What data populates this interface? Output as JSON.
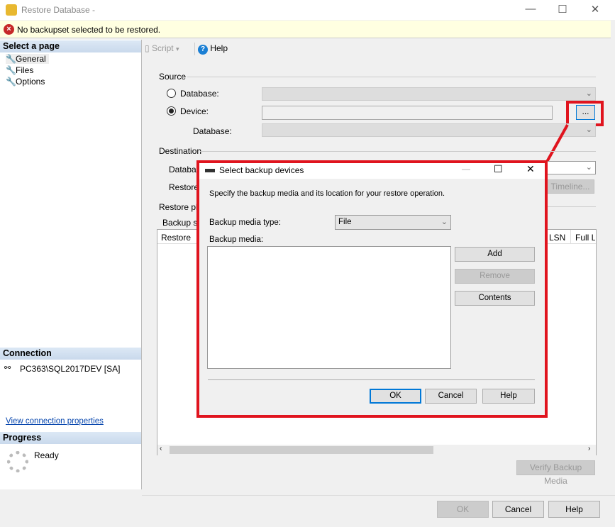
{
  "window": {
    "title": "Restore Database -",
    "minimize": "—",
    "maximize": "☐",
    "close": "✕"
  },
  "error": {
    "message": "No backupset selected to be restored."
  },
  "sidebar": {
    "header": "Select a page",
    "items": [
      {
        "label": "General"
      },
      {
        "label": "Files"
      },
      {
        "label": "Options"
      }
    ],
    "connection_header": "Connection",
    "connection": "PC363\\SQL2017DEV [SA]",
    "connection_link": "View connection properties",
    "progress_header": "Progress",
    "progress_status": "Ready"
  },
  "toolbar": {
    "script": "Script",
    "help": "Help"
  },
  "source": {
    "label": "Source",
    "database_radio": "Database:",
    "device_radio": "Device:",
    "device_value": "",
    "browse": "...",
    "database_label": "Database:"
  },
  "destination": {
    "label": "Destination",
    "database_label": "Database:",
    "restore_to_label": "Restore to:",
    "timeline": "Timeline..."
  },
  "restore_plan": {
    "label": "Restore plan",
    "backup_sets_label": "Backup sets to restore:",
    "columns": [
      "Restore",
      "LSN",
      "Full LSN"
    ],
    "verify": "Verify Backup Media"
  },
  "footer": {
    "ok": "OK",
    "cancel": "Cancel",
    "help": "Help"
  },
  "dialog": {
    "title": "Select backup devices",
    "description": "Specify the backup media and its location for your restore operation.",
    "media_type_label": "Backup media type:",
    "media_type_value": "File",
    "media_label": "Backup media:",
    "add": "Add",
    "remove": "Remove",
    "contents": "Contents",
    "ok": "OK",
    "cancel": "Cancel",
    "help": "Help",
    "minimize": "—",
    "maximize": "☐",
    "close": "✕"
  }
}
